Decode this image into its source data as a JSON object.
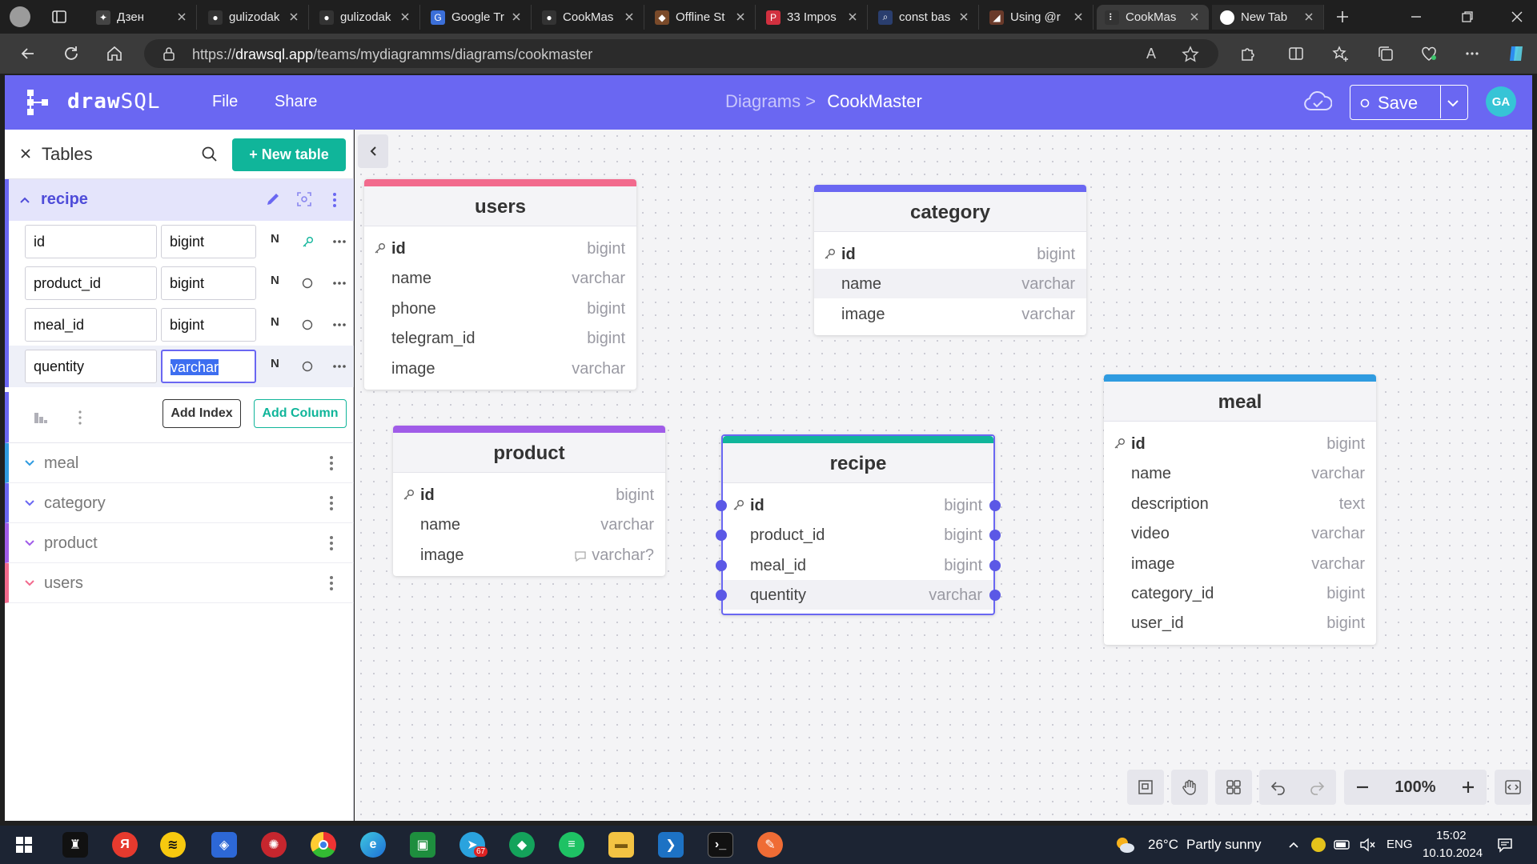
{
  "browser": {
    "tabs": [
      {
        "title": "Дзен",
        "favicon_color": "#444444",
        "favicon_glyph": "✦"
      },
      {
        "title": "gulizodak",
        "favicon_color": "#333333",
        "favicon_glyph": "●"
      },
      {
        "title": "gulizodak",
        "favicon_color": "#333333",
        "favicon_glyph": "●"
      },
      {
        "title": "Google Tr",
        "favicon_color": "#3b6fd8",
        "favicon_glyph": "G"
      },
      {
        "title": "CookMas",
        "favicon_color": "#333333",
        "favicon_glyph": "●"
      },
      {
        "title": "Offline St",
        "favicon_color": "#7a4a2a",
        "favicon_glyph": "◆"
      },
      {
        "title": "33 Impos",
        "favicon_color": "#d1303f",
        "favicon_glyph": "P"
      },
      {
        "title": "const bas",
        "favicon_color": "#2a3e6e",
        "favicon_glyph": "⌕"
      },
      {
        "title": "Using @r",
        "favicon_color": "#6a3a2a",
        "favicon_glyph": "◢"
      },
      {
        "title": "CookMas",
        "favicon_color": "#333333",
        "favicon_glyph": "⠇",
        "active": true
      },
      {
        "title": "New Tab",
        "favicon_color": "#ffffff",
        "favicon_glyph": ""
      }
    ],
    "url_prefix": "https://",
    "url_host": "drawsql.app",
    "url_path": "/teams/mydiagramms/diagrams/cookmaster"
  },
  "app": {
    "logo_bold": "draw",
    "logo_rest": "SQL",
    "menu": {
      "file": "File",
      "share": "Share"
    },
    "breadcrumb_parent": "Diagrams >",
    "breadcrumb_current": "CookMaster",
    "save_label": "Save",
    "avatar": "GA",
    "accent": "#6a67f2"
  },
  "sidebar": {
    "title": "Tables",
    "new_table_label": "+ New table",
    "expanded_table": "recipe",
    "columns": [
      {
        "name": "id",
        "type": "bigint",
        "nullable": "N",
        "key": true
      },
      {
        "name": "product_id",
        "type": "bigint",
        "nullable": "N",
        "key": false
      },
      {
        "name": "meal_id",
        "type": "bigint",
        "nullable": "N",
        "key": false
      },
      {
        "name": "quentity",
        "type": "varchar",
        "nullable": "N",
        "key": false
      }
    ],
    "add_index_label": "Add Index",
    "add_column_label": "Add Column",
    "other_tables": [
      {
        "name": "meal",
        "color": "#2f9be0"
      },
      {
        "name": "category",
        "color": "#6a67f2"
      },
      {
        "name": "product",
        "color": "#a05ce8"
      },
      {
        "name": "users",
        "color": "#f26a8d"
      }
    ]
  },
  "diagram": {
    "tables": {
      "users": {
        "title": "users",
        "color": "#f26a8d",
        "columns": [
          {
            "name": "id",
            "type": "bigint",
            "pk": true
          },
          {
            "name": "name",
            "type": "varchar"
          },
          {
            "name": "phone",
            "type": "bigint"
          },
          {
            "name": "telegram_id",
            "type": "bigint"
          },
          {
            "name": "image",
            "type": "varchar"
          }
        ]
      },
      "category": {
        "title": "category",
        "color": "#6a67f2",
        "columns": [
          {
            "name": "id",
            "type": "bigint",
            "pk": true
          },
          {
            "name": "name",
            "type": "varchar"
          },
          {
            "name": "image",
            "type": "varchar"
          }
        ]
      },
      "product": {
        "title": "product",
        "color": "#a05ce8",
        "columns": [
          {
            "name": "id",
            "type": "bigint",
            "pk": true
          },
          {
            "name": "name",
            "type": "varchar"
          },
          {
            "name": "image",
            "type": "varchar?"
          }
        ]
      },
      "recipe": {
        "title": "recipe",
        "color": "#10b59a",
        "columns": [
          {
            "name": "id",
            "type": "bigint",
            "pk": true
          },
          {
            "name": "product_id",
            "type": "bigint"
          },
          {
            "name": "meal_id",
            "type": "bigint"
          },
          {
            "name": "quentity",
            "type": "varchar"
          }
        ]
      },
      "meal": {
        "title": "meal",
        "color": "#2f9be0",
        "columns": [
          {
            "name": "id",
            "type": "bigint",
            "pk": true
          },
          {
            "name": "name",
            "type": "varchar"
          },
          {
            "name": "description",
            "type": "text"
          },
          {
            "name": "video",
            "type": "varchar"
          },
          {
            "name": "image",
            "type": "varchar"
          },
          {
            "name": "category_id",
            "type": "bigint"
          },
          {
            "name": "user_id",
            "type": "bigint"
          }
        ]
      }
    },
    "zoom": "100%"
  },
  "taskbar": {
    "weather_temp": "26°C",
    "weather_desc": "Partly sunny",
    "language": "ENG",
    "time": "15:02",
    "date": "10.10.2024",
    "telegram_badge": "67"
  }
}
